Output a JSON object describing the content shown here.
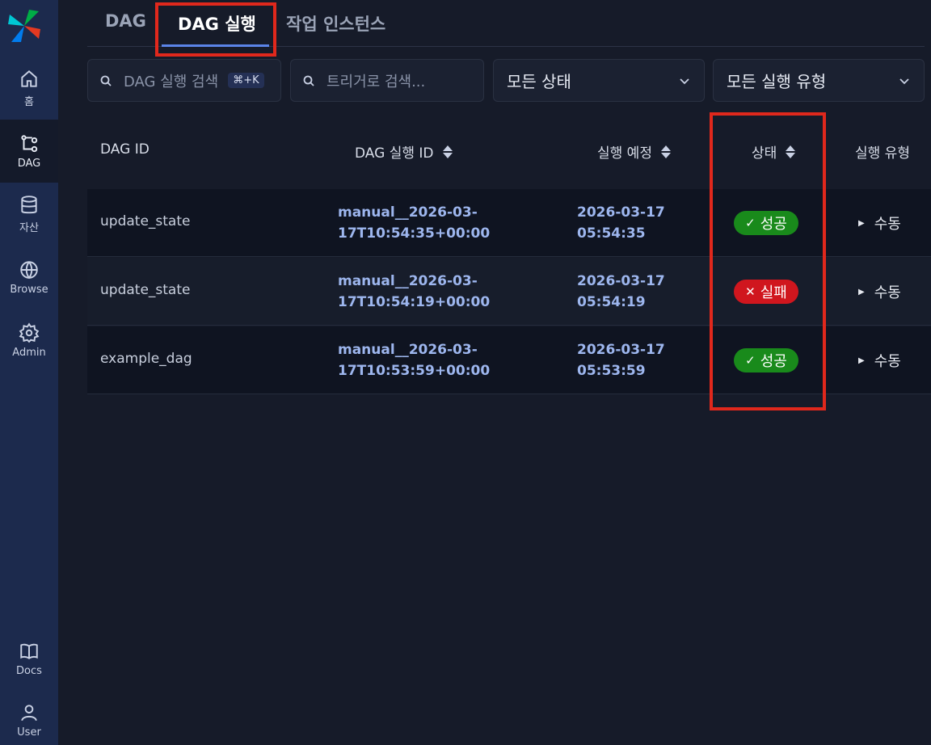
{
  "sidebar": {
    "items": [
      {
        "label": "홈",
        "icon": "home-icon"
      },
      {
        "label": "DAG",
        "icon": "dag-icon"
      },
      {
        "label": "자산",
        "icon": "database-icon"
      },
      {
        "label": "Browse",
        "icon": "globe-icon"
      },
      {
        "label": "Admin",
        "icon": "gear-icon"
      },
      {
        "label": "Docs",
        "icon": "book-icon"
      },
      {
        "label": "User",
        "icon": "user-icon"
      }
    ]
  },
  "tabs": [
    {
      "label": "DAG"
    },
    {
      "label": "DAG 실행"
    },
    {
      "label": "작업 인스턴스"
    }
  ],
  "filters": {
    "search_placeholder": "DAG 실행 검색",
    "shortcut": "⌘+K",
    "trigger_placeholder": "트리거로 검색...",
    "state_select": "모든 상태",
    "run_type_select": "모든 실행 유형"
  },
  "table": {
    "headers": {
      "dag_id": "DAG ID",
      "run_id": "DAG 실행 ID",
      "run_after": "실행 예정",
      "state": "상태",
      "run_type": "실행 유형"
    },
    "rows": [
      {
        "dag_id": "update_state",
        "run_id_1": "manual__2026-03-",
        "run_id_2": "17T10:54:35+00:00",
        "date": "2026-03-17",
        "time": "05:54:35",
        "state": "성공",
        "state_kind": "success",
        "run_type": "수동"
      },
      {
        "dag_id": "update_state",
        "run_id_1": "manual__2026-03-",
        "run_id_2": "17T10:54:19+00:00",
        "date": "2026-03-17",
        "time": "05:54:19",
        "state": "실패",
        "state_kind": "failed",
        "run_type": "수동"
      },
      {
        "dag_id": "example_dag",
        "run_id_1": "manual__2026-03-",
        "run_id_2": "17T10:53:59+00:00",
        "date": "2026-03-17",
        "time": "05:53:59",
        "state": "성공",
        "state_kind": "success",
        "run_type": "수동"
      }
    ]
  },
  "colors": {
    "success": "#198a1b",
    "failed": "#d0161e",
    "accent": "#5b84e8",
    "highlight": "#e0281c"
  }
}
